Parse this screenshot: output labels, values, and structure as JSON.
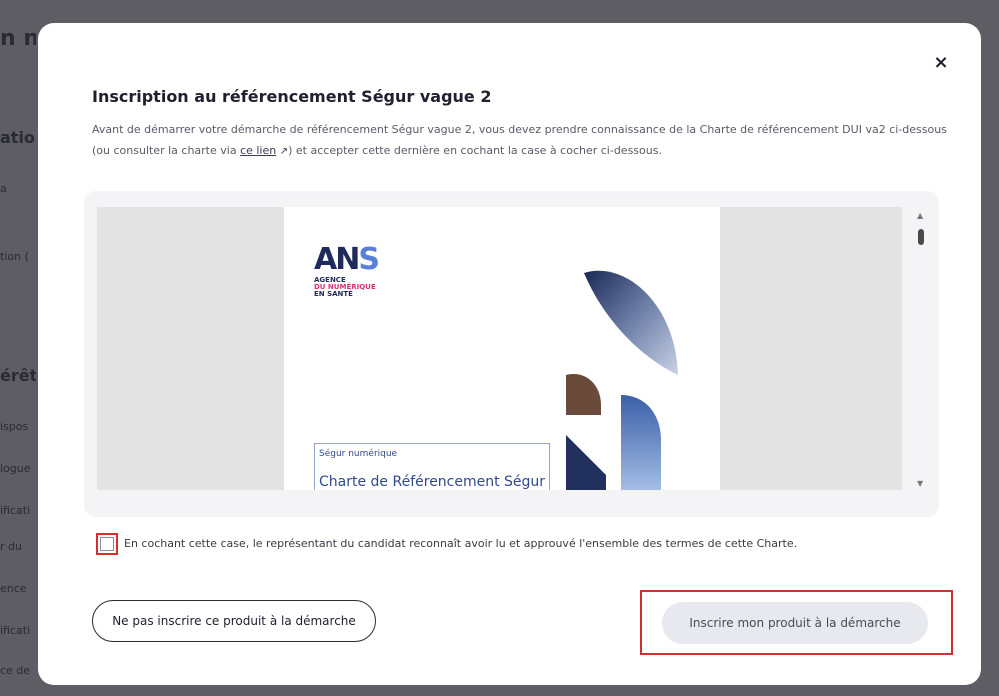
{
  "background": {
    "title_fragment": "n n",
    "section1_fragment": "ation",
    "line1_fragment": "a",
    "line2_fragment": "tion (",
    "section2_fragment": "érêt",
    "items": [
      "ispos",
      "logue",
      "ificati",
      "r du",
      "ence",
      "ificati",
      "ce de"
    ]
  },
  "modal": {
    "close_glyph": "×",
    "title": "Inscription au référencement Ségur vague 2",
    "desc_part1": "Avant de démarrer votre démarche de référencement Ségur vague 2, vous devez prendre connaissance de la Charte de référencement DUI va2 ci-dessous (ou consulter la charte via ",
    "desc_link": "ce lien",
    "desc_part2": ") et accepter cette dernière en cochant la case à cocher ci-dessous.",
    "external_icon_glyph": "↗"
  },
  "pdf": {
    "logo_text": "ANS",
    "logo_line1": "AGENCE",
    "logo_line2": "DU NUMÉRIQUE",
    "logo_line3": "EN SANTÉ",
    "doc_kicker": "Ségur numérique",
    "doc_title": "Charte de Référencement Ségur"
  },
  "scrollbar": {
    "up_glyph": "▲",
    "down_glyph": "▼"
  },
  "checkbox": {
    "checked": false,
    "label": "En cochant cette case, le représentant du candidat reconnaît avoir lu et approuvé l'ensemble des termes de cette Charte."
  },
  "buttons": {
    "decline": "Ne pas inscrire ce produit à la démarche",
    "register": "Inscrire mon produit à la démarche"
  },
  "colors": {
    "highlight": "#d32f2f",
    "brand_navy": "#1f2a5c",
    "brand_pink": "#e0307a",
    "disabled_button": "#e8e8ef"
  }
}
